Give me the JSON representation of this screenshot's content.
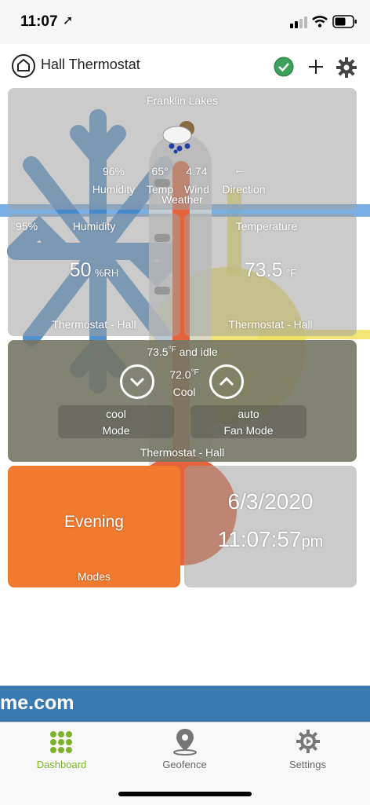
{
  "status_bar": {
    "time": "11:07",
    "location_arrow": "➚"
  },
  "header": {
    "title": "Hall Thermostat"
  },
  "weather": {
    "location": "Franklin Lakes",
    "humidity_value": "96%",
    "humidity_label": "Humidity",
    "temp_value": "65°",
    "temp_label": "Temp",
    "wind_value": "4.74",
    "wind_label": "Wind",
    "direction_value": "←",
    "direction_label": "Direction",
    "tile_label": "Weather"
  },
  "humidity_tile": {
    "battery": "95%",
    "title": "Humidity",
    "value": "50",
    "unit": "%RH",
    "footer": "Thermostat - Hall"
  },
  "temperature_tile": {
    "title": "Temperature",
    "value": "73.5",
    "unit": "°F",
    "footer": "Thermostat - Hall"
  },
  "thermostat": {
    "status_temp": "73.5",
    "status_unit": "°F",
    "status_text": "and idle",
    "setpoint": "72.0",
    "setpoint_unit": "°F",
    "mode_label": "Cool",
    "mode_value": "cool",
    "mode_caption": "Mode",
    "fan_value": "auto",
    "fan_caption": "Fan Mode",
    "footer": "Thermostat - Hall"
  },
  "modes_tile": {
    "value": "Evening",
    "footer": "Modes"
  },
  "clock_tile": {
    "date": "6/3/2020",
    "time": "11:07:57",
    "ampm": "pm"
  },
  "banner": {
    "text": "me.com"
  },
  "tabs": [
    {
      "label": "Dashboard",
      "icon": "dashboard-grid-icon",
      "color": "#7cb32a"
    },
    {
      "label": "Geofence",
      "icon": "location-pin-icon",
      "color": "#777777"
    },
    {
      "label": "Settings",
      "icon": "gear-icon",
      "color": "#777777"
    }
  ],
  "colors": {
    "accent_green": "#7cb32a",
    "orange": "#f07a2e",
    "banner_blue": "#3a7ab3",
    "check_green": "#3aa05a"
  }
}
